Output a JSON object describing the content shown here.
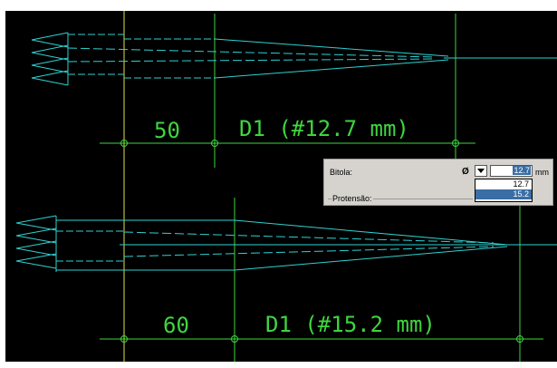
{
  "drawing": {
    "top_dimensions": {
      "length": "50",
      "cable": "D1 (#12.7 mm)"
    },
    "bottom_dimensions": {
      "length": "60",
      "cable": "D1 (#15.2 mm)"
    },
    "colors": {
      "background": "#000000",
      "strands": "#2fd1d1",
      "dimension": "#3fd53f",
      "axis": "#e1e14a"
    }
  },
  "panel": {
    "bitola_label": "Bitola:",
    "diameter_symbol": "Ø",
    "value": "12.7",
    "unit": "mm",
    "options": [
      "12.7",
      "15.2"
    ],
    "highlighted_option": "15.2",
    "section_label": "Protensão:"
  }
}
